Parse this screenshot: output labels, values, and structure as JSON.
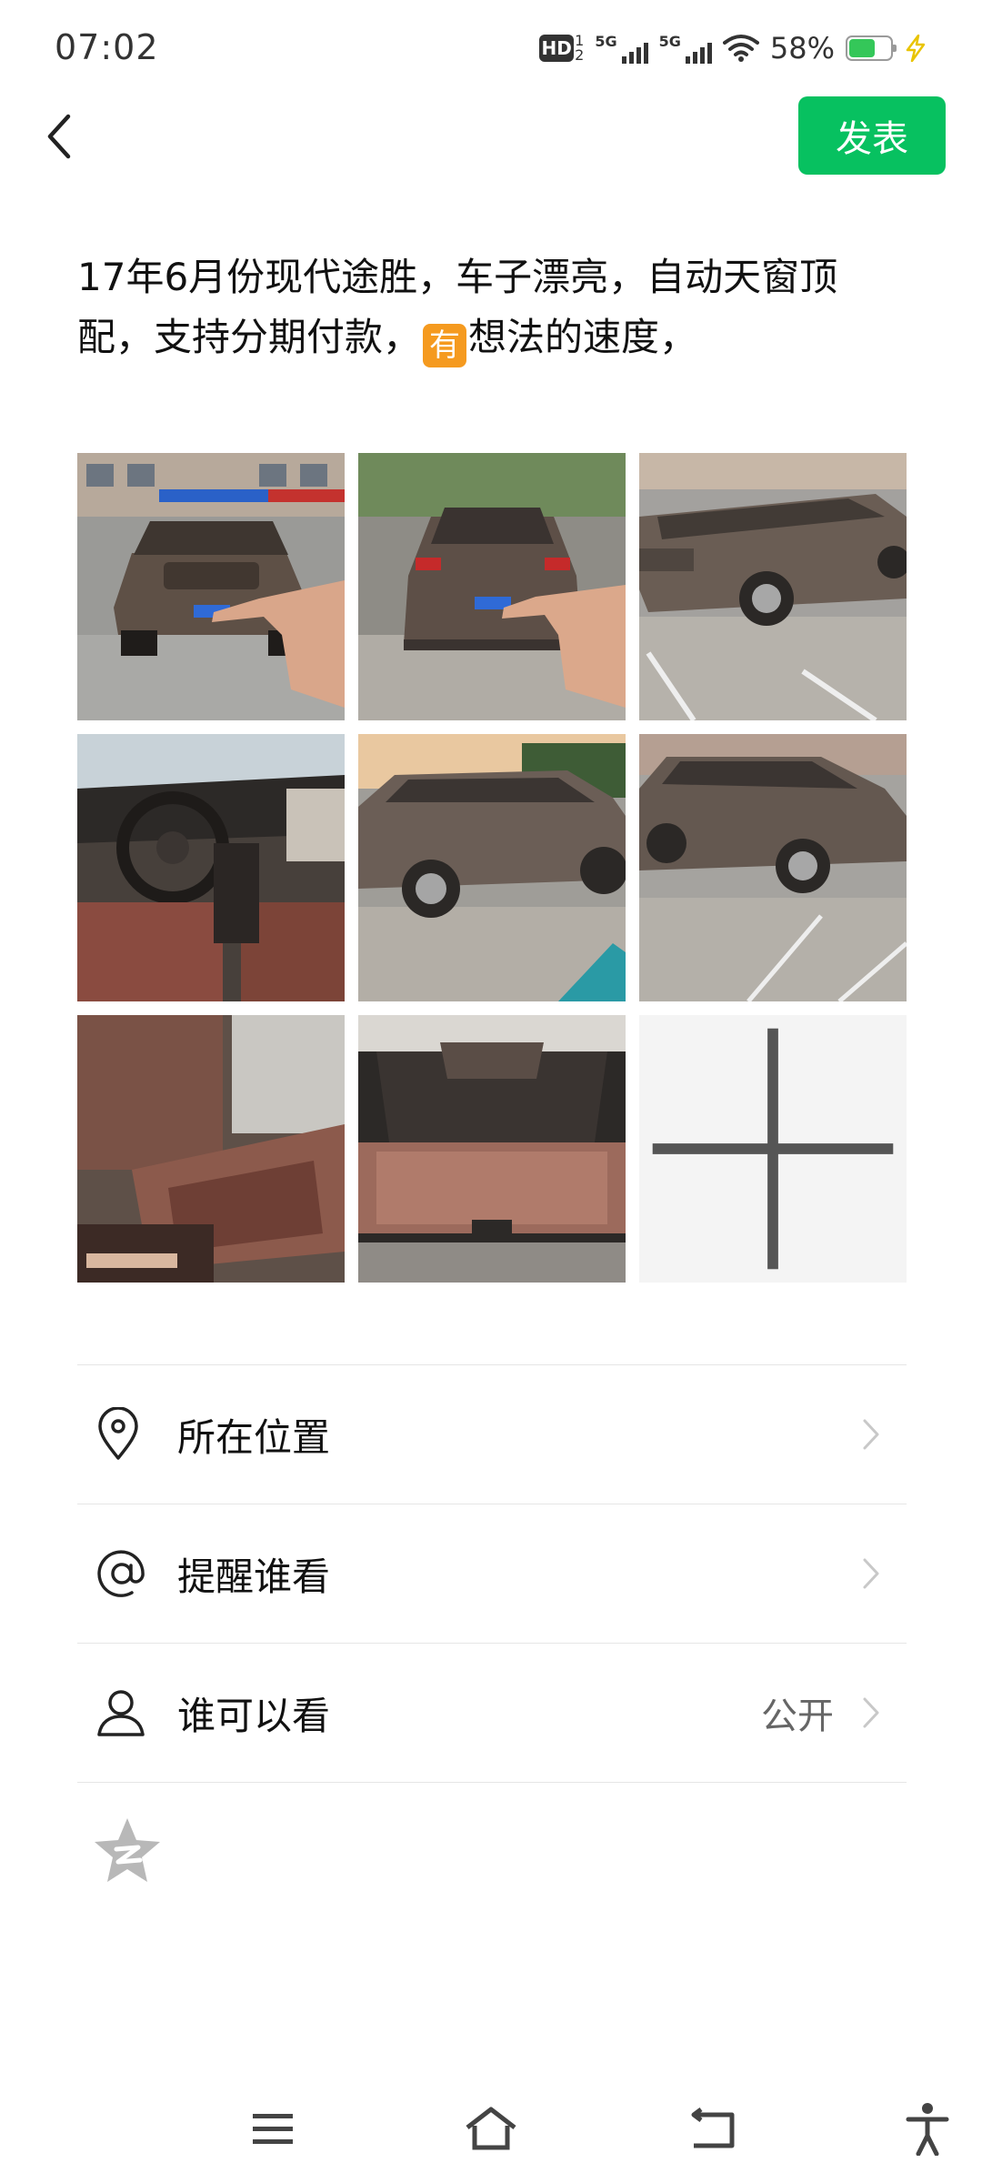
{
  "status_bar": {
    "time": "07:02",
    "hd_label": "HD",
    "sim1_sup": "1",
    "sim1_sub": "2",
    "network1": "5G",
    "network2": "5G",
    "battery_percent": "58%",
    "battery_level": 0.58
  },
  "header": {
    "back_icon": "chevron-left-icon",
    "publish_label": "发表"
  },
  "post": {
    "text_before_emoji": "17年6月份现代途胜，车子漂亮，自动天窗顶配，支持分期付款，",
    "emoji_char": "有",
    "text_after_emoji": "想法的速度，"
  },
  "photos": {
    "count": 8,
    "add_icon": "plus-icon"
  },
  "settings": {
    "location_label": "所在位置",
    "mention_label": "提醒谁看",
    "visibility_label": "谁可以看",
    "visibility_value": "公开"
  },
  "colors": {
    "accent": "#07c160",
    "emoji_bg": "#f59a1f"
  },
  "nav_bar": {
    "icons": [
      "menu-icon",
      "home-icon",
      "back-icon",
      "accessibility-icon"
    ]
  }
}
